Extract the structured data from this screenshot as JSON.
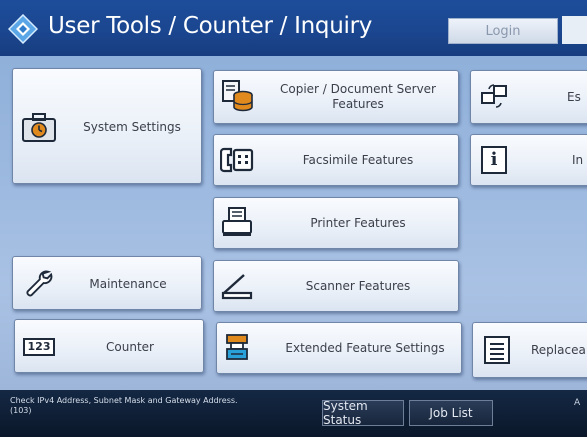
{
  "header": {
    "title": "User Tools / Counter / Inquiry",
    "login_label": "Login"
  },
  "buttons": {
    "system_settings": "System Settings",
    "copier": "Copier / Document Server Features",
    "facsimile": "Facsimile Features",
    "printer": "Printer Features",
    "scanner": "Scanner Features",
    "extended": "Extended Feature Settings",
    "maintenance": "Maintenance",
    "counter": "Counter",
    "counter_icon_text": "123",
    "right_top_partial": "Es",
    "right_mid_partial": "In",
    "right_bottom_partial": "Replacea"
  },
  "footer": {
    "message_line1": "Check IPv4 Address, Subnet Mask and Gateway Address.",
    "message_line2": "(103)",
    "system_status": "System Status",
    "job_list": "Job List",
    "edge_text": "A"
  },
  "icons": {
    "header_logo": "diamond-logo-icon",
    "system_settings": "toolbox-clock-icon",
    "copier": "copier-document-icon",
    "facsimile": "fax-phone-icon",
    "printer": "printer-icon",
    "scanner": "scanner-icon",
    "extended": "extended-settings-icon",
    "maintenance": "wrench-icon",
    "counter": "counter-123-icon",
    "right_top": "screen-switch-icon",
    "right_mid": "info-icon",
    "right_bottom": "list-icon"
  },
  "colors": {
    "header_blue": "#1b4690",
    "panel_blue": "#9ab7de",
    "footer_dark": "#0b1729",
    "icon_orange": "#e08a1e",
    "icon_dark": "#1e2a3a"
  }
}
